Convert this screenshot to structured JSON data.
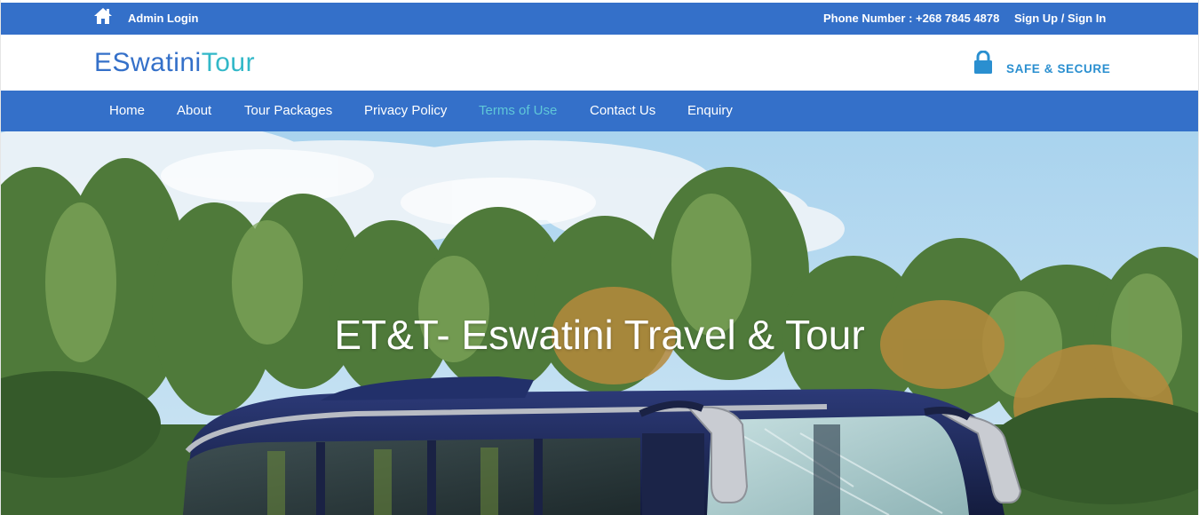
{
  "topbar": {
    "admin_login": "Admin Login",
    "phone": "Phone Number : +268 7845 4878",
    "auth": "Sign Up / Sign In",
    "icon": "home-icon"
  },
  "header": {
    "logo_part1": "ESwatini",
    "logo_part2": "Tour",
    "secure_label": "SAFE & SECURE",
    "secure_icon": "lock-icon"
  },
  "nav": {
    "items": [
      {
        "label": "Home",
        "active": false
      },
      {
        "label": "About",
        "active": false
      },
      {
        "label": "Tour Packages",
        "active": false
      },
      {
        "label": "Privacy Policy",
        "active": false
      },
      {
        "label": "Terms of Use",
        "active": true
      },
      {
        "label": "Contact Us",
        "active": false
      },
      {
        "label": "Enquiry",
        "active": false
      }
    ]
  },
  "hero": {
    "title": "ET&T- Eswatini Travel & Tour"
  },
  "colors": {
    "primary": "#3470c9",
    "accent": "#32b8c8",
    "active_nav": "#5fc7d8",
    "secure": "#2a8fd0"
  }
}
